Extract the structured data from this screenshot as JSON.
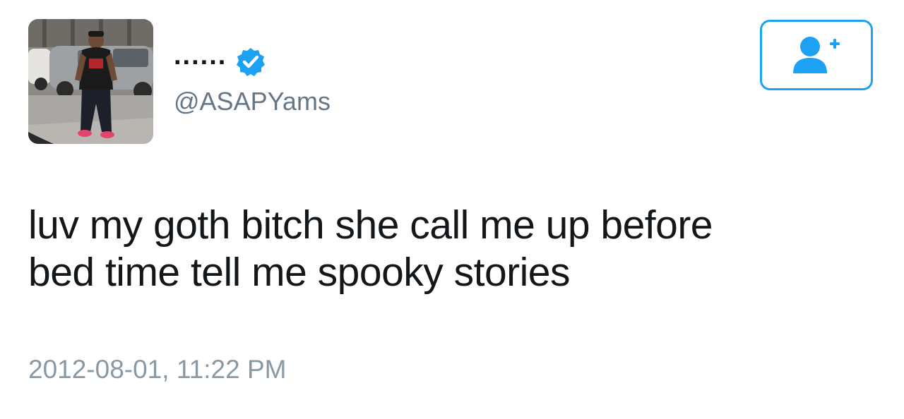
{
  "author": {
    "display_name": "......",
    "handle": "@ASAPYams",
    "verified": true,
    "avatar_icon": "profile-photo"
  },
  "follow_button": {
    "icon": "add-user-icon",
    "accent_color": "#1da1f2"
  },
  "tweet": {
    "text_line1": "luv my goth bitch she call me up before",
    "text_line2": "bed time tell me spooky stories",
    "timestamp": "2012-08-01, 11:22 PM"
  },
  "colors": {
    "text": "#14171a",
    "handle": "#657786",
    "timestamp": "#8899a6",
    "verified_badge": "#1da1f2"
  }
}
